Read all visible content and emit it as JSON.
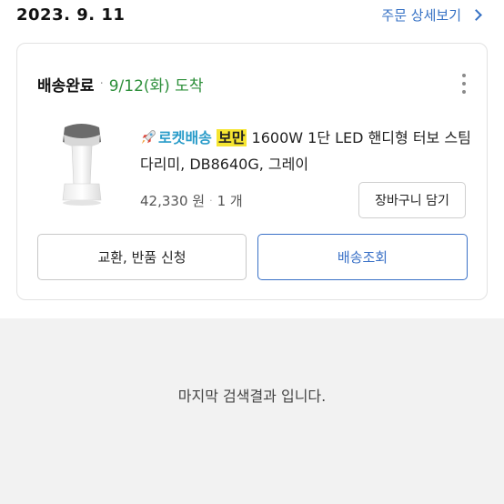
{
  "order": {
    "date": "2023. 9. 11",
    "detail_link": "주문 상세보기"
  },
  "card": {
    "status": "배송완료",
    "arrival": "9/12(화) 도착",
    "product": {
      "badge_rocket": "로켓배송",
      "badge_boman": "보만",
      "name": "1600W 1단 LED 핸디형 터보 스팀다리미, DB8640G, 그레이",
      "price": "42,330 원",
      "quantity": "1 개"
    },
    "cart_button": "장바구니 담기",
    "exchange_button": "교환, 반품 신청",
    "track_button": "배송조회"
  },
  "footer": {
    "last_result": "마지막 검색결과 입니다."
  },
  "icons": {
    "rocket": "rocket-icon",
    "more": "kebab-menu-icon",
    "chevron": "chevron-right-icon"
  },
  "colors": {
    "link_blue": "#3470c4",
    "arrival_green": "#2d8f3a",
    "rocket_blue": "#2a9cc9",
    "highlight_yellow": "#f6e531"
  }
}
